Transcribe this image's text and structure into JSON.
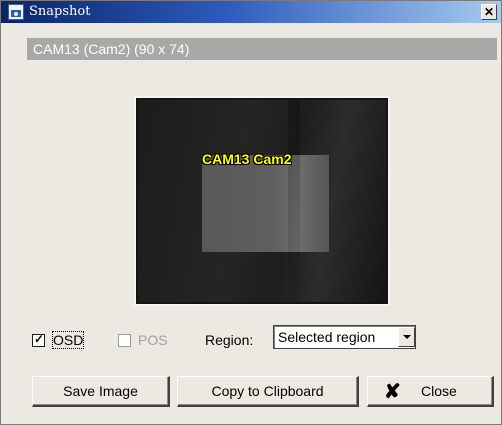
{
  "window": {
    "title": "Snapshot",
    "title_icon": "camera-app-icon",
    "close_glyph": "✕"
  },
  "caption": {
    "text": "CAM13 (Cam2) (90 x 74)"
  },
  "preview": {
    "osd_text": "CAM13 Cam2"
  },
  "options": {
    "osd": {
      "label": "OSD",
      "checked": true
    },
    "pos": {
      "label": "POS",
      "checked": false,
      "disabled": true
    },
    "region_label": "Region:",
    "region_selected": "Selected region"
  },
  "buttons": {
    "save_image": "Save Image",
    "copy_clipboard": "Copy to Clipboard",
    "close": "Close",
    "close_icon": "x-icon"
  },
  "colors": {
    "title_gradient_start": "#0a246a",
    "title_gradient_end": "#a6caf0",
    "caption_bar": "#a8a8a8",
    "dialog_bg": "#ece9e2",
    "osd_text": "#ffff00"
  }
}
